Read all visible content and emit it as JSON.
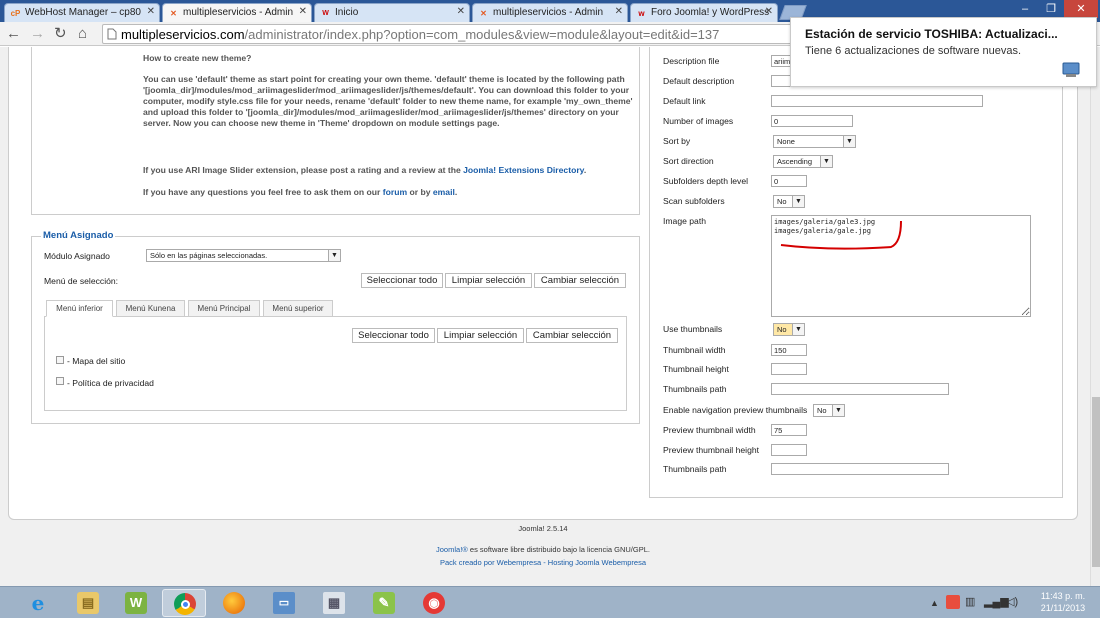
{
  "browser": {
    "tabs": [
      {
        "icon": "cP",
        "label": "WebHost Manager – cp80",
        "active": false
      },
      {
        "icon": "✕",
        "label": "multipleservicios - Admin",
        "active": true
      },
      {
        "icon": "W",
        "label": "Inicio",
        "active": false
      },
      {
        "icon": "✕",
        "label": "multipleservicios - Admin",
        "active": false
      },
      {
        "icon": "w",
        "label": "Foro Joomla! y WordPress",
        "active": false
      }
    ],
    "url_host": "multipleservicios.com",
    "url_path": "/administrator/index.php?option=com_modules&view=module&layout=edit&id=137"
  },
  "help": {
    "heading": "How to create new theme?",
    "p1": "You can use 'default' theme as start point for creating your own theme. 'default' theme is located by the following path '[joomla_dir]/modules/mod_ariimageslider/mod_ariimageslider/js/themes/default'. You can download this folder to your computer, modify style.css file for your needs, rename 'default' folder to new theme name, for example 'my_own_theme' and upload this folder to '[joomla_dir]/modules/mod_ariimageslider/mod_ariimageslider/js/themes' directory on your server. Now you can choose new theme in 'Theme' dropdown on module settings page.",
    "p2_pre": "If you use ARI Image Slider extension, please post a rating and a review at the ",
    "p2_link": "Joomla! Extensions Directory",
    "p2_post": ".",
    "p3_pre": "If you have any questions you feel free to ask them on our ",
    "p3_link1": "forum",
    "p3_mid": " or by ",
    "p3_link2": "email",
    "p3_post": "."
  },
  "menu_assign": {
    "legend": "Menú Asignado",
    "module_label": "Módulo Asignado",
    "module_value": "Sólo en las páginas seleccionadas.",
    "selection_label": "Menú de selección:",
    "select_all": "Seleccionar todo",
    "clear_selection": "Limpiar selección",
    "toggle_selection": "Cambiar selección",
    "tabs": [
      "Menú inferior",
      "Menú Kunena",
      "Menú Principal",
      "Menú superior"
    ],
    "items": [
      "- Mapa del sitio",
      "- Política de privacidad"
    ]
  },
  "options": {
    "description_file_label": "Description file",
    "description_file_value": "ariima",
    "default_description_label": "Default description",
    "default_link_label": "Default link",
    "number_of_images_label": "Number of images",
    "number_of_images_value": "0",
    "sort_by_label": "Sort by",
    "sort_by_value": "None",
    "sort_direction_label": "Sort direction",
    "sort_direction_value": "Ascending",
    "subfolders_depth_label": "Subfolders depth level",
    "subfolders_depth_value": "0",
    "scan_subfolders_label": "Scan subfolders",
    "scan_subfolders_value": "No",
    "image_path_label": "Image path",
    "image_path_value": "images/galeria/gale3.jpg\nimages/galeria/gale.jpg",
    "use_thumbnails_label": "Use thumbnails",
    "use_thumbnails_value": "No",
    "thumbnail_width_label": "Thumbnail width",
    "thumbnail_width_value": "150",
    "thumbnail_height_label": "Thumbnail height",
    "thumbnails_path_label": "Thumbnails path",
    "enable_nav_preview_label": "Enable navigation preview thumbnails",
    "enable_nav_preview_value": "No",
    "preview_thumb_width_label": "Preview thumbnail width",
    "preview_thumb_width_value": "75",
    "preview_thumb_height_label": "Preview thumbnail height",
    "thumbnails_path2_label": "Thumbnails path"
  },
  "footer": {
    "version": "Joomla! 2.5.14",
    "license_link": "Joomla!®",
    "license_text": " es software libre distribuido bajo la licencia GNU/GPL.",
    "credit": "Pack creado por Webempresa - Hosting Joomla Webempresa"
  },
  "notification": {
    "title": "Estación de servicio TOSHIBA: Actualizaci...",
    "body": "Tiene 6 actualizaciones de software nuevas."
  },
  "taskbar": {
    "time": "11:43 p. m.",
    "date": "21/11/2013"
  },
  "colors": {
    "link": "#1a5da8",
    "annotation": "#d40000",
    "highlight_select": "#ffe8a6"
  }
}
